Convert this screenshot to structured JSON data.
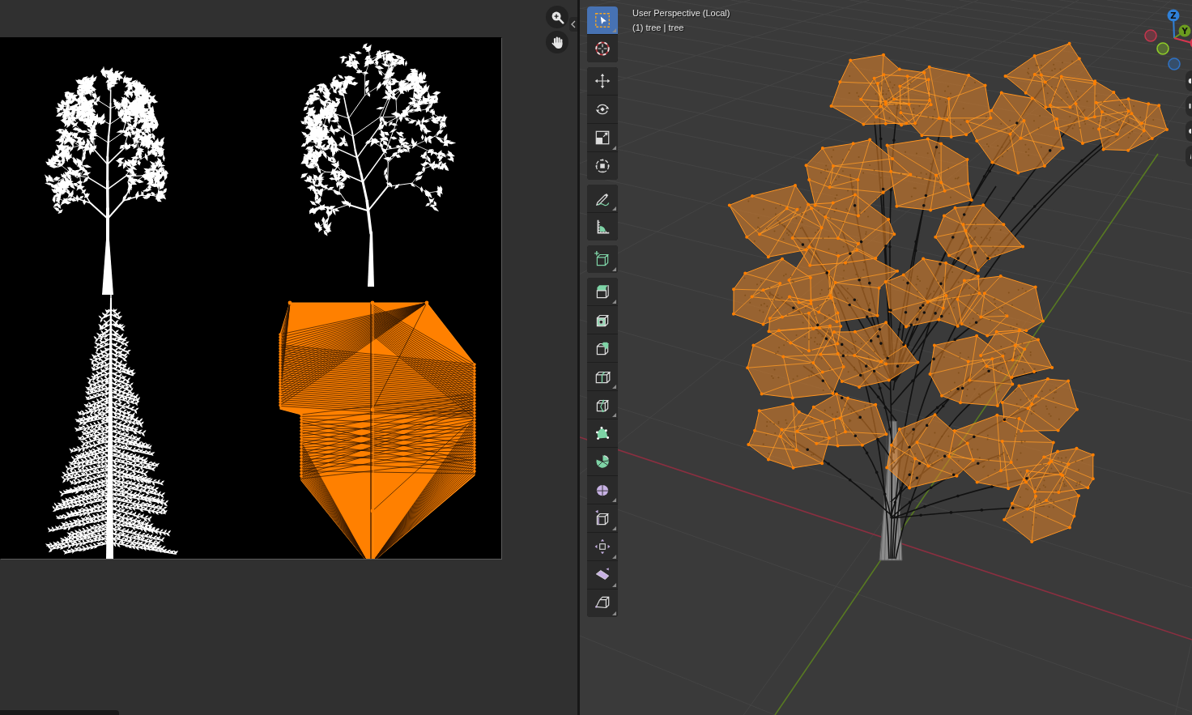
{
  "image_editor": {
    "tools": [
      {
        "kind": "zoom"
      },
      {
        "kind": "pan"
      }
    ]
  },
  "viewport": {
    "header": {
      "view": "User Perspective (Local)",
      "object": "(1) tree | tree"
    },
    "toolbar": {
      "groups": [
        {
          "tools": [
            {
              "kind": "select",
              "selected": true,
              "has_menu": true
            },
            {
              "kind": "cursor",
              "selected": false,
              "has_menu": false
            }
          ]
        },
        {
          "tools": [
            {
              "kind": "move",
              "selected": false,
              "has_menu": false
            },
            {
              "kind": "rotate",
              "selected": false,
              "has_menu": false
            },
            {
              "kind": "scale",
              "selected": false,
              "has_menu": true
            },
            {
              "kind": "transform",
              "selected": false,
              "has_menu": false
            }
          ]
        },
        {
          "tools": [
            {
              "kind": "annotate",
              "selected": false,
              "has_menu": true
            },
            {
              "kind": "measure",
              "selected": false,
              "has_menu": false
            }
          ]
        },
        {
          "tools": [
            {
              "kind": "addcube",
              "selected": false,
              "has_menu": true
            }
          ]
        },
        {
          "tools": [
            {
              "kind": "extrude",
              "selected": false,
              "has_menu": true
            },
            {
              "kind": "inset",
              "selected": false,
              "has_menu": false
            },
            {
              "kind": "bevel",
              "selected": false,
              "has_menu": false
            },
            {
              "kind": "loopcut",
              "selected": false,
              "has_menu": true
            },
            {
              "kind": "knife",
              "selected": false,
              "has_menu": true
            },
            {
              "kind": "polybuild",
              "selected": false,
              "has_menu": false
            },
            {
              "kind": "spin",
              "selected": false,
              "has_menu": false
            },
            {
              "kind": "smooth",
              "selected": false,
              "has_menu": true
            },
            {
              "kind": "slide",
              "selected": false,
              "has_menu": true
            },
            {
              "kind": "shrink",
              "selected": false,
              "has_menu": true
            },
            {
              "kind": "shear",
              "selected": false,
              "has_menu": true
            },
            {
              "kind": "rip",
              "selected": false,
              "has_menu": true
            }
          ]
        }
      ]
    },
    "gizmo": {
      "axes": [
        {
          "kind": "positive",
          "label": "Z",
          "color": "#2f80d8"
        },
        {
          "kind": "positive",
          "label": "Y",
          "color": "#6b9b1f"
        },
        {
          "kind": "positive",
          "color": "#d8354f"
        },
        {
          "kind": "negative",
          "color": "#c4364d"
        },
        {
          "kind": "negative",
          "color": "#8ecb28"
        },
        {
          "kind": "negative",
          "color": "#2f72c4"
        }
      ]
    }
  }
}
